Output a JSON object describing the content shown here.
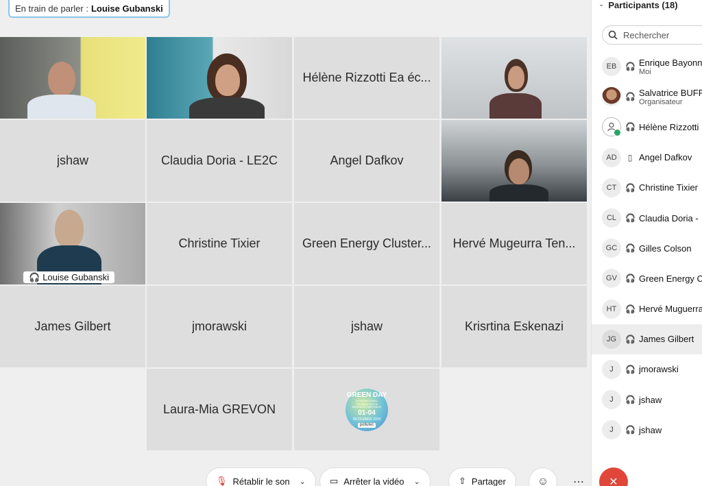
{
  "speaker": {
    "label": "En train de parler :",
    "name": "Louise Gubanski"
  },
  "tiles": {
    "hele": "Hélène Rizzotti Ea éc...",
    "jshaw1": "jshaw",
    "claudia": "Claudia Doria - LE2C",
    "angel": "Angel Dafkov",
    "louise": "Louise Gubanski",
    "christine": "Christine Tixier",
    "green": "Green Energy Cluster...",
    "herve": "Hervé Mugeurra Ten...",
    "james": "James Gilbert",
    "jmorawski": "jmorawski",
    "jshaw2": "jshaw",
    "krisrtina": "Krisrtina Eskenazi",
    "laura": "Laura-Mia GREVON"
  },
  "logo": {
    "line1": "GREEN DAY",
    "line2": "INTERNATIONAL TECHNOLOGY & BUSINESS MEETINGS",
    "dates": "01-04",
    "month": "DECEMBER 2020",
    "tag": "pollutec"
  },
  "panel": {
    "title": "Participants (18)",
    "search_placeholder": "Rechercher",
    "participants": [
      {
        "initials": "EB",
        "name": "Enrique Bayonne",
        "sub": "Moi",
        "icon": "headset-icon"
      },
      {
        "initials": "",
        "name": "Salvatrice BUFFA",
        "sub": "Organisateur",
        "icon": "headset-icon"
      },
      {
        "initials": "",
        "name": "Hélène Rizzotti",
        "sub": "",
        "icon": "headset-icon"
      },
      {
        "initials": "AD",
        "name": "Angel Dafkov",
        "sub": "",
        "icon": "phone-icon"
      },
      {
        "initials": "CT",
        "name": "Christine Tixier",
        "sub": "",
        "icon": "headset-icon"
      },
      {
        "initials": "CL",
        "name": "Claudia Doria -",
        "sub": "",
        "icon": "headset-icon"
      },
      {
        "initials": "GC",
        "name": "Gilles Colson",
        "sub": "",
        "icon": "headset-icon"
      },
      {
        "initials": "GV",
        "name": "Green Energy C",
        "sub": "",
        "icon": "headset-icon"
      },
      {
        "initials": "HT",
        "name": "Hervé Muguerra",
        "sub": "",
        "icon": "headset-icon"
      },
      {
        "initials": "JG",
        "name": "James Gilbert",
        "sub": "",
        "icon": "headset-icon"
      },
      {
        "initials": "J",
        "name": "jmorawski",
        "sub": "",
        "icon": "headset-icon"
      },
      {
        "initials": "J",
        "name": "jshaw",
        "sub": "",
        "icon": "headset-icon"
      },
      {
        "initials": "J",
        "name": "jshaw",
        "sub": "",
        "icon": "headset-icon"
      }
    ]
  },
  "toolbar": {
    "unmute_label": "Rétablir le son",
    "video_label": "Arrêter la vidéo",
    "share_label": "Partager"
  },
  "colors": {
    "active_border": "#4fb3e8",
    "end_call": "#e0463a",
    "presence": "#2aa56a"
  }
}
